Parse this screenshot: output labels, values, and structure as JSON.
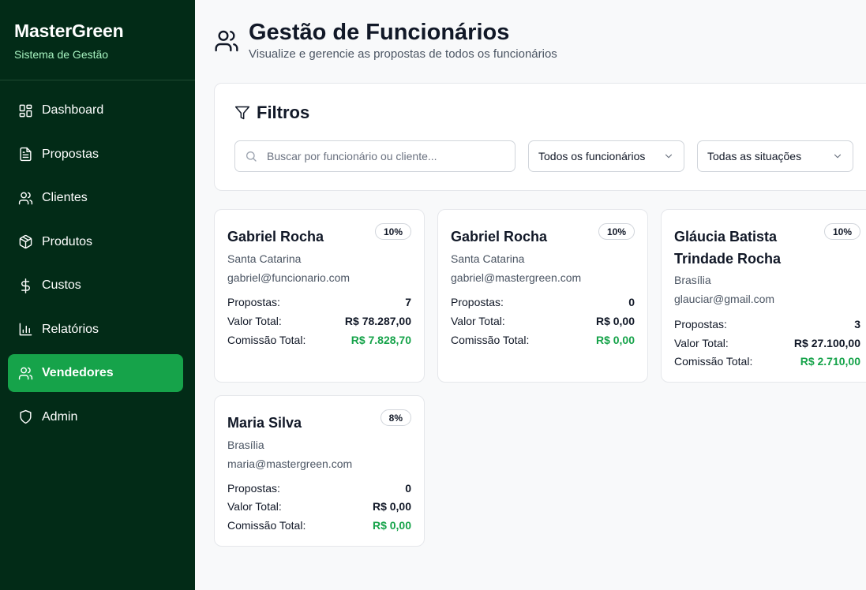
{
  "brand": {
    "title": "MasterGreen",
    "subtitle": "Sistema de Gestão"
  },
  "sidebar": {
    "items": [
      {
        "label": "Dashboard",
        "icon": "dashboard-icon"
      },
      {
        "label": "Propostas",
        "icon": "file-text-icon"
      },
      {
        "label": "Clientes",
        "icon": "users-icon"
      },
      {
        "label": "Produtos",
        "icon": "package-icon"
      },
      {
        "label": "Custos",
        "icon": "dollar-icon"
      },
      {
        "label": "Relatórios",
        "icon": "bar-chart-icon"
      },
      {
        "label": "Vendedores",
        "icon": "users-icon",
        "active": true
      },
      {
        "label": "Admin",
        "icon": "shield-icon"
      }
    ]
  },
  "header": {
    "title": "Gestão de Funcionários",
    "subtitle": "Visualize e gerencie as propostas de todos os funcionários"
  },
  "filters": {
    "title": "Filtros",
    "search_placeholder": "Buscar por funcionário ou cliente...",
    "employee_select": "Todos os funcionários",
    "status_select": "Todas as situações"
  },
  "labels": {
    "proposals": "Propostas:",
    "total_value": "Valor Total:",
    "total_commission": "Comissão Total:"
  },
  "employees": [
    {
      "name": "Gabriel Rocha",
      "commission_rate": "10%",
      "region": "Santa Catarina",
      "email": "gabriel@funcionario.com",
      "proposals": "7",
      "total_value": "R$ 78.287,00",
      "total_commission": "R$ 7.828,70"
    },
    {
      "name": "Gabriel Rocha",
      "commission_rate": "10%",
      "region": "Santa Catarina",
      "email": "gabriel@mastergreen.com",
      "proposals": "0",
      "total_value": "R$ 0,00",
      "total_commission": "R$ 0,00"
    },
    {
      "name": "Gláucia Batista Trindade Rocha",
      "commission_rate": "10%",
      "region": "Brasília",
      "email": "glauciar@gmail.com",
      "proposals": "3",
      "total_value": "R$ 27.100,00",
      "total_commission": "R$ 2.710,00"
    },
    {
      "name": "Maria Silva",
      "commission_rate": "8%",
      "region": "Brasília",
      "email": "maria@mastergreen.com",
      "proposals": "0",
      "total_value": "R$ 0,00",
      "total_commission": "R$ 0,00"
    }
  ],
  "colors": {
    "sidebar_bg": "#022b17",
    "accent": "#16a34a"
  }
}
